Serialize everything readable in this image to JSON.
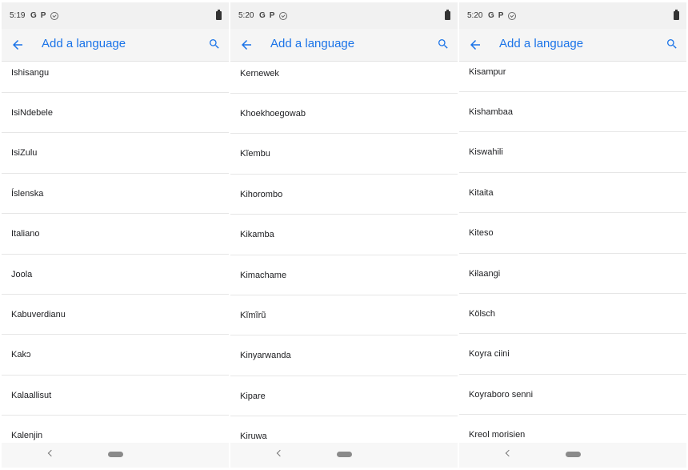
{
  "accent_color": "#1a73e8",
  "screens": [
    {
      "status_time": "5:19",
      "status_icons": [
        "G",
        "P"
      ],
      "title": "Add a language",
      "items": [
        "Ishisangu",
        "IsiNdebele",
        "IsiZulu",
        "Íslenska",
        "Italiano",
        "Joola",
        "Kabuverdianu",
        "Kakɔ",
        "Kalaallisut",
        "Kalenjin"
      ]
    },
    {
      "status_time": "5:20",
      "status_icons": [
        "G",
        "P"
      ],
      "title": "Add a language",
      "items": [
        "Kernewek",
        "Khoekhoegowab",
        "Kĩembu",
        "Kihorombo",
        "Kikamba",
        "Kimachame",
        "Kĩmĩrũ",
        "Kinyarwanda",
        "Kipare",
        "Kiruwa"
      ]
    },
    {
      "status_time": "5:20",
      "status_icons": [
        "G",
        "P"
      ],
      "title": "Add a language",
      "items": [
        "Kisampur",
        "Kishambaa",
        "Kiswahili",
        "Kitaita",
        "Kiteso",
        "Kɨlaangi",
        "Kölsch",
        "Koyra ciini",
        "Koyraboro senni",
        "Kreol morisien"
      ]
    }
  ]
}
